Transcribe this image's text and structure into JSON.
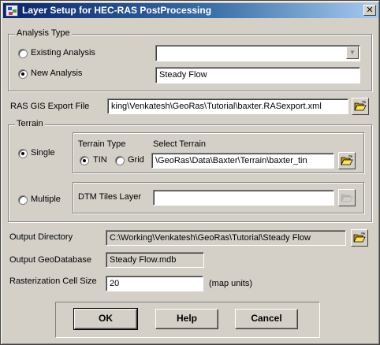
{
  "window": {
    "title": "Layer Setup for HEC-RAS PostProcessing",
    "close_glyph": "✕"
  },
  "analysis_type": {
    "group_label": "Analysis Type",
    "existing_label": "Existing Analysis",
    "existing_value": "",
    "new_label": "New Analysis",
    "new_value": "Steady Flow",
    "selected": "New Analysis"
  },
  "export_file": {
    "label": "RAS GIS Export File",
    "value": "king\\Venkatesh\\GeoRas\\Tutorial\\baxter.RASexport.xml"
  },
  "terrain": {
    "group_label": "Terrain",
    "single_label": "Single",
    "multiple_label": "Multiple",
    "selected": "Single",
    "type_label": "Terrain Type",
    "tin_label": "TIN",
    "grid_label": "Grid",
    "type_selected": "TIN",
    "select_label": "Select Terrain",
    "select_value": "\\GeoRas\\Data\\Baxter\\Terrain\\baxter_tin",
    "dtm_label": "DTM Tiles Layer",
    "dtm_value": ""
  },
  "output": {
    "dir_label": "Output Directory",
    "dir_value": "C:\\Working\\Venkatesh\\GeoRas\\Tutorial\\Steady Flow",
    "gdb_label": "Output GeoDatabase",
    "gdb_value": "Steady Flow.mdb",
    "cell_label": "Rasterization Cell Size",
    "cell_value": "20",
    "cell_units": "(map units)"
  },
  "buttons": {
    "ok": "OK",
    "help": "Help",
    "cancel": "Cancel"
  },
  "icons": [
    "app-icon",
    "close-icon",
    "open-folder-icon",
    "dropdown-arrow-icon"
  ]
}
